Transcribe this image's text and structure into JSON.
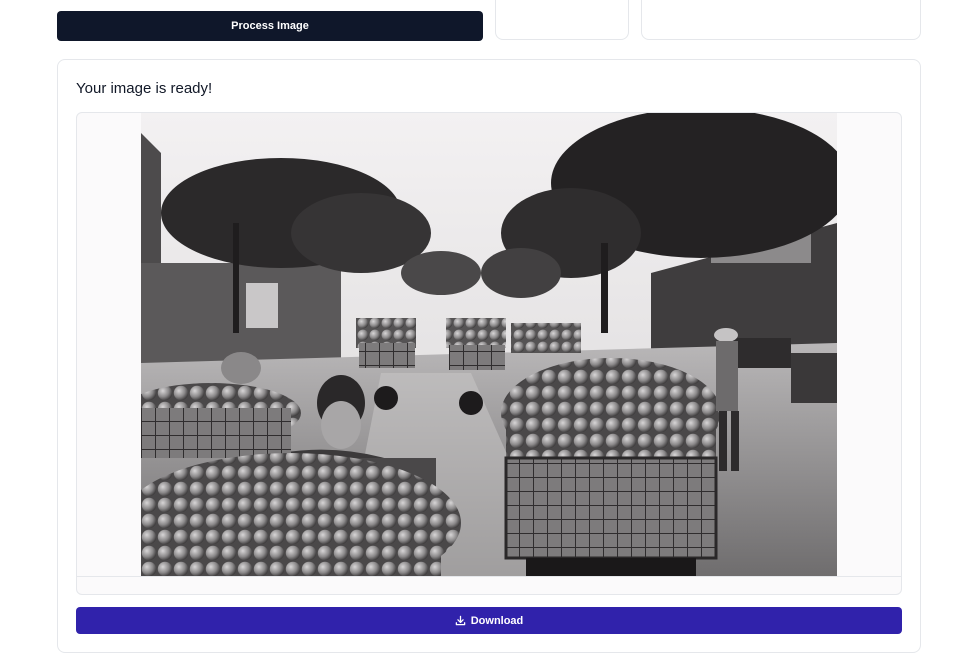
{
  "toolbar": {
    "process_label": "Process Image"
  },
  "result": {
    "title": "Your image is ready!",
    "image_alt": "Black and white street market photo with carts of lychee fruit",
    "download_label": "Download",
    "download_icon": "download-icon"
  },
  "colors": {
    "process_button": "#0f172a",
    "download_button": "#3022ab",
    "card_border": "#e5e7eb"
  }
}
